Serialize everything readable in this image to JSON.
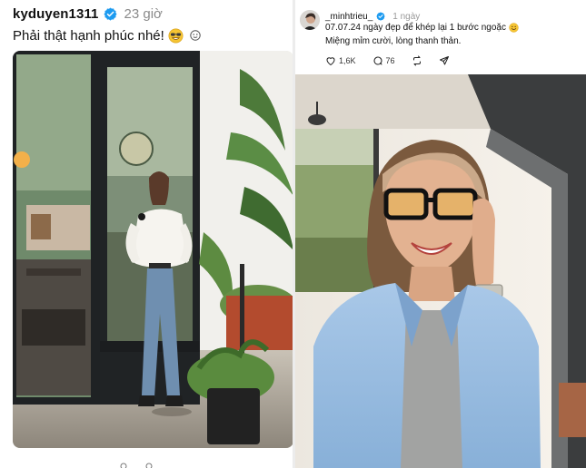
{
  "left_post": {
    "username": "kyduyen1311",
    "time": "23 giờ",
    "caption": "Phải thật hạnh phúc nhé!",
    "photo": "woman-standing-at-cafe-doorway"
  },
  "right_post": {
    "username": "_minhtrieu_",
    "time": "1 ngày",
    "text_line1": "07.07.24 ngày đẹp để khép lại 1 bước ngoặc",
    "text_line2": "Miệng mỉm cười, lòng thanh thản.",
    "likes": "1,6K",
    "comments": "76",
    "photo": "woman-with-glasses-selfie"
  },
  "colors": {
    "verified": "#1d9bf0",
    "muted": "#8a8a8a"
  },
  "icons": {
    "verified": "verified-badge-icon",
    "like": "heart-icon",
    "comment": "comment-icon",
    "repost": "repost-icon",
    "share": "share-icon"
  }
}
